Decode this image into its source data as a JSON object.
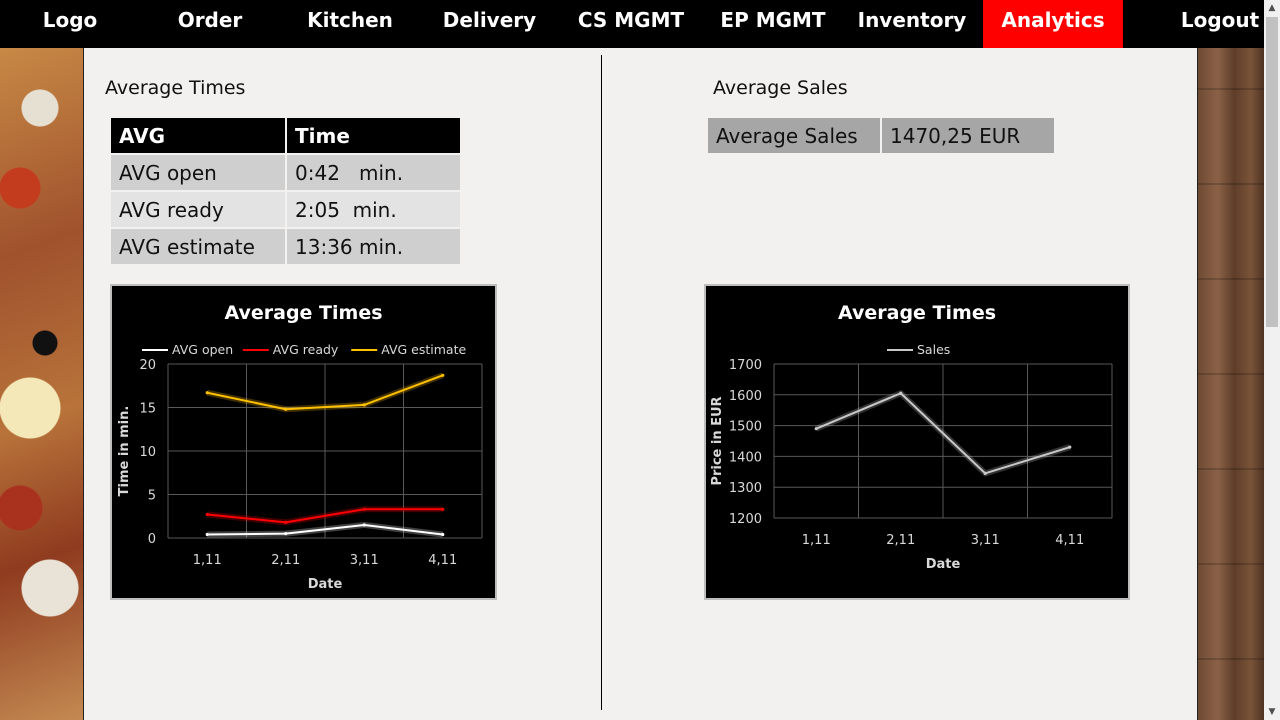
{
  "nav": {
    "items": [
      "Logo",
      "Order",
      "Kitchen",
      "Delivery",
      "CS MGMT",
      "EP MGMT",
      "Inventory",
      "Analytics",
      "Logout"
    ],
    "active": "Analytics",
    "active_color": "#ff0000"
  },
  "times": {
    "title": "Average Times",
    "headers": [
      "AVG",
      "Time"
    ],
    "rows": [
      {
        "label": "AVG open",
        "value": "0:42   min."
      },
      {
        "label": "AVG ready",
        "value": "2:05  min."
      },
      {
        "label": "AVG estimate",
        "value": "13:36 min."
      }
    ]
  },
  "sales": {
    "title": "Average Sales",
    "label": "Average Sales",
    "value": "1470,25 EUR"
  },
  "chart_data": [
    {
      "type": "line",
      "title": "Average Times",
      "xlabel": "Date",
      "ylabel": "Time in min.",
      "categories": [
        "1,11",
        "2,11",
        "3,11",
        "4,11"
      ],
      "ylim": [
        0,
        20
      ],
      "yticks": [
        0,
        5,
        10,
        15,
        20
      ],
      "grid": true,
      "legend": "top",
      "series": [
        {
          "name": "AVG open",
          "color": "#ffffff",
          "values": [
            0.4,
            0.5,
            1.5,
            0.4
          ]
        },
        {
          "name": "AVG ready",
          "color": "#ff0000",
          "values": [
            2.7,
            1.8,
            3.3,
            3.3
          ]
        },
        {
          "name": "AVG estimate",
          "color": "#ffc000",
          "values": [
            16.7,
            14.8,
            15.3,
            18.7
          ]
        }
      ]
    },
    {
      "type": "line",
      "title": "Average Times",
      "xlabel": "Date",
      "ylabel": "Price in EUR",
      "categories": [
        "1,11",
        "2,11",
        "3,11",
        "4,11"
      ],
      "ylim": [
        1200,
        1700
      ],
      "yticks": [
        1200,
        1300,
        1400,
        1500,
        1600,
        1700
      ],
      "grid": true,
      "legend": "top",
      "series": [
        {
          "name": "Sales",
          "color": "#c8c8c8",
          "values": [
            1490,
            1605,
            1345,
            1430
          ]
        }
      ]
    }
  ]
}
